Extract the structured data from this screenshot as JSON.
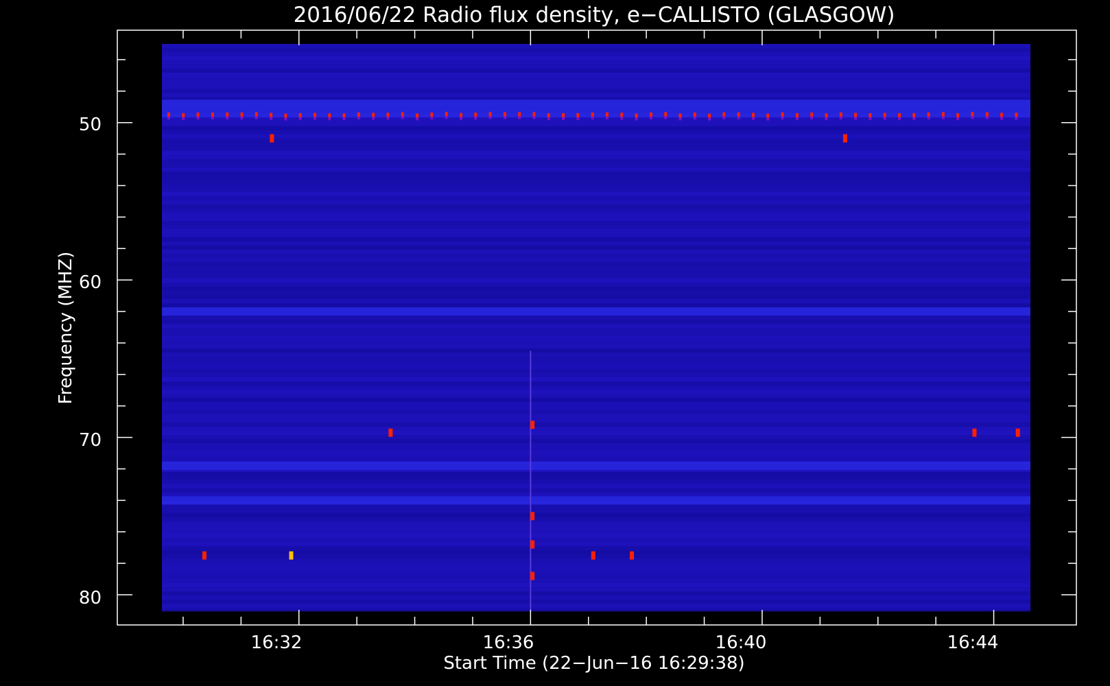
{
  "chart_data": {
    "type": "heatmap",
    "title": "2016/06/22  Radio flux density, e−CALLISTO (GLASGOW)",
    "xlabel": "Start Time (22−Jun−16 16:29:38)",
    "ylabel": "Frequency (MHZ)",
    "x_range": [
      "16:29:38",
      "16:44:38"
    ],
    "y_range": [
      45,
      81
    ],
    "y_inverted": true,
    "x_ticks": [
      "16:32",
      "16:36",
      "16:40",
      "16:44"
    ],
    "y_ticks": [
      "50",
      "60",
      "70",
      "80"
    ],
    "colors": {
      "background": "#000000",
      "axes": "#ffffff",
      "spectrogram_base": "#1c10b4",
      "emission_high": "#ff2000",
      "emission_peak": "#ffc000"
    },
    "features": [
      {
        "name": "persistent interference band",
        "freq_mhz": 49.5,
        "time_start": "16:29:38",
        "time_end": "16:44:38"
      },
      {
        "name": "brighter band",
        "freq_mhz": 62.0,
        "time_start": "16:29:38",
        "time_end": "16:44:38"
      },
      {
        "name": "brighter band",
        "freq_mhz": 71.8,
        "time_start": "16:29:38",
        "time_end": "16:44:38"
      },
      {
        "name": "brighter band",
        "freq_mhz": 74.0,
        "time_start": "16:29:38",
        "time_end": "16:44:38"
      },
      {
        "name": "vertical burst line",
        "time": "16:36:00",
        "freq_start_mhz": 64.5,
        "freq_end_mhz": 81
      }
    ]
  }
}
